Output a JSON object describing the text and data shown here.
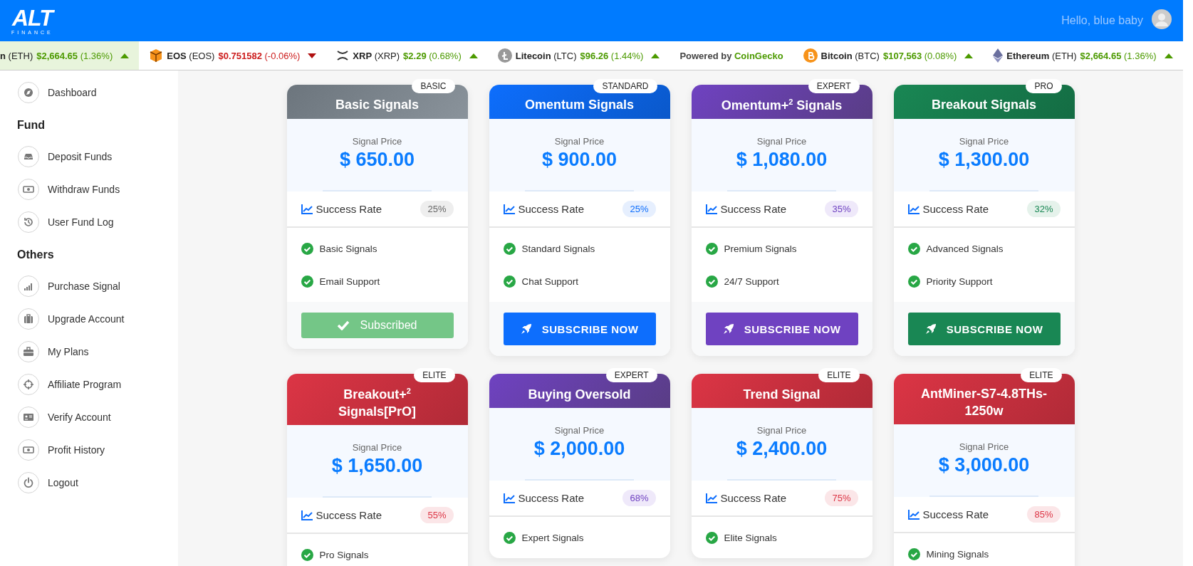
{
  "header": {
    "logo": "ALT",
    "logo_sub": "FINANCE",
    "greeting": "Hello, blue baby"
  },
  "ticker": [
    {
      "kind": "coin",
      "name": "n",
      "symbol": "(ETH)",
      "price": "$2,664.65",
      "change": "(1.36%)",
      "rising": true,
      "highlighted": true
    },
    {
      "kind": "coin",
      "name": "EOS",
      "symbol": "(EOS)",
      "price": "$0.751582",
      "change": "(-0.06%)",
      "rising": false,
      "highlighted": false
    },
    {
      "kind": "coin",
      "name": "XRP",
      "symbol": "(XRP)",
      "price": "$2.29",
      "change": "(0.68%)",
      "rising": true,
      "highlighted": false
    },
    {
      "kind": "coin",
      "name": "Litecoin",
      "symbol": "(LTC)",
      "price": "$96.26",
      "change": "(1.44%)",
      "rising": true,
      "highlighted": false
    },
    {
      "kind": "credit",
      "text": "Powered by",
      "link": "CoinGecko"
    },
    {
      "kind": "coin",
      "name": "Bitcoin",
      "symbol": "(BTC)",
      "price": "$107,563",
      "change": "(0.08%)",
      "rising": true,
      "highlighted": false
    },
    {
      "kind": "coin",
      "name": "Ethereum",
      "symbol": "(ETH)",
      "price": "$2,664.65",
      "change": "(1.36%)",
      "rising": true,
      "highlighted": false
    }
  ],
  "sidebar": {
    "sections": [
      {
        "items": [
          {
            "label": "Dashboard"
          }
        ]
      },
      {
        "heading": "Fund",
        "items": [
          {
            "label": "Deposit Funds"
          },
          {
            "label": "Withdraw Funds"
          },
          {
            "label": "User Fund Log"
          }
        ]
      },
      {
        "heading": "Others",
        "items": [
          {
            "label": "Purchase Signal"
          },
          {
            "label": "Upgrade Account"
          },
          {
            "label": "My Plans"
          },
          {
            "label": "Affiliate Program"
          },
          {
            "label": "Verify Account"
          },
          {
            "label": "Profit History"
          },
          {
            "label": "Logout"
          }
        ]
      }
    ]
  },
  "plans": [
    {
      "kind": "basic",
      "badge": "BASIC",
      "title": "Basic Signals",
      "price_label": "Signal Price",
      "price": "$ 650.00",
      "rate_label": "Success Rate",
      "rate": "25%",
      "features": [
        "Basic Signals",
        "Email Support"
      ],
      "button": "Subscribed",
      "subscribed": true
    },
    {
      "kind": "standard",
      "badge": "STANDARD",
      "title": "Omentum Signals",
      "price_label": "Signal Price",
      "price": "$ 900.00",
      "rate_label": "Success Rate",
      "rate": "25%",
      "features": [
        "Standard Signals",
        "Chat Support"
      ],
      "button": "SUBSCRIBE NOW",
      "subscribed": false
    },
    {
      "kind": "expert",
      "badge": "EXPERT",
      "title": "Omentum+$^{2}$ Signals",
      "price_label": "Signal Price",
      "price": "$ 1,080.00",
      "rate_label": "Success Rate",
      "rate": "35%",
      "features": [
        "Premium Signals",
        "24/7 Support"
      ],
      "button": "SUBSCRIBE NOW",
      "subscribed": false
    },
    {
      "kind": "pro",
      "badge": "PRO",
      "title": "Breakout Signals",
      "price_label": "Signal Price",
      "price": "$ 1,300.00",
      "rate_label": "Success Rate",
      "rate": "32%",
      "features": [
        "Advanced Signals",
        "Priority Support"
      ],
      "button": "SUBSCRIBE NOW",
      "subscribed": false
    },
    {
      "kind": "elite",
      "badge": "ELITE",
      "title": "Breakout+$^{2}$ Signals[PrO]",
      "price_label": "Signal Price",
      "price": "$ 1,650.00",
      "rate_label": "Success Rate",
      "rate": "55%",
      "features": [
        "Pro Signals"
      ]
    },
    {
      "kind": "expert",
      "badge": "EXPERT",
      "title": "Buying Oversold",
      "price_label": "Signal Price",
      "price": "$ 2,000.00",
      "rate_label": "Success Rate",
      "rate": "68%",
      "features": [
        "Expert Signals"
      ]
    },
    {
      "kind": "elite",
      "badge": "ELITE",
      "title": "Trend Signal",
      "price_label": "Signal Price",
      "price": "$ 2,400.00",
      "rate_label": "Success Rate",
      "rate": "75%",
      "features": [
        "Elite Signals"
      ]
    },
    {
      "kind": "elite",
      "badge": "ELITE",
      "title": "AntMiner-S7-4.8THs-1250w",
      "price_label": "Signal Price",
      "price": "$ 3,000.00",
      "rate_label": "Success Rate",
      "rate": "85%",
      "features": [
        "Mining Signals"
      ]
    }
  ]
}
